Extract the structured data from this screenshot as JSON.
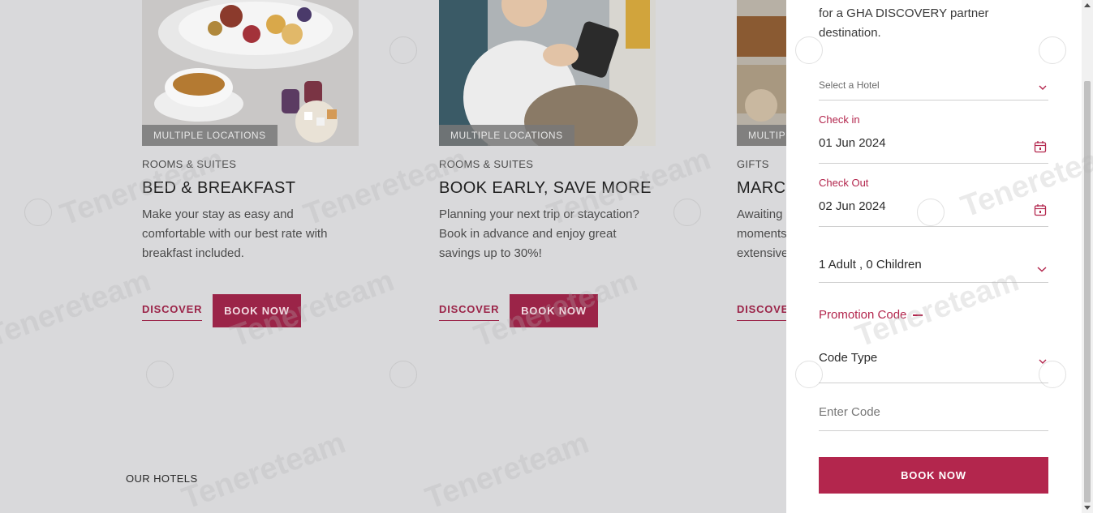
{
  "cards": [
    {
      "badge": "MULTIPLE LOCATIONS",
      "category": "ROOMS & SUITES",
      "title": "BED & BREAKFAST",
      "description": "Make your stay as easy and comfortable with our best rate with breakfast included.",
      "discover_label": "DISCOVER",
      "book_label": "BOOK NOW"
    },
    {
      "badge": "MULTIPLE LOCATIONS",
      "category": "ROOMS & SUITES",
      "title": "BOOK EARLY, SAVE MORE",
      "description": "Planning your next trip or staycation? Book in advance and enjoy great savings up to 30%!",
      "discover_label": "DISCOVER",
      "book_label": "BOOK NOW"
    },
    {
      "badge": "MULTIPLE LOCATIONS",
      "category": "GIFTS",
      "title": "MARCO",
      "description": "Awaiting moments extensive",
      "discover_label": "DISCOVER"
    }
  ],
  "footer": {
    "our_hotels": "OUR HOTELS"
  },
  "booking_panel": {
    "intro": "for a GHA DISCOVERY partner destination.",
    "hotel_placeholder": "Select a Hotel",
    "check_in_label": "Check in",
    "check_in_value": "01 Jun 2024",
    "check_out_label": "Check Out",
    "check_out_value": "02 Jun 2024",
    "guests_value": "1 Adult , 0 Children",
    "promotion_label": "Promotion Code",
    "code_type_value": "Code Type",
    "enter_code_placeholder": "Enter Code",
    "submit_label": "BOOK NOW"
  },
  "watermark": {
    "text": "Tenereteam"
  },
  "colors": {
    "accent": "#b3264d",
    "accent_dark": "#9b2448",
    "overlay_bg": "#d9d9db",
    "panel_bg": "#ffffff"
  },
  "icons": [
    "chevron-down-icon",
    "calendar-icon",
    "minus-icon"
  ]
}
